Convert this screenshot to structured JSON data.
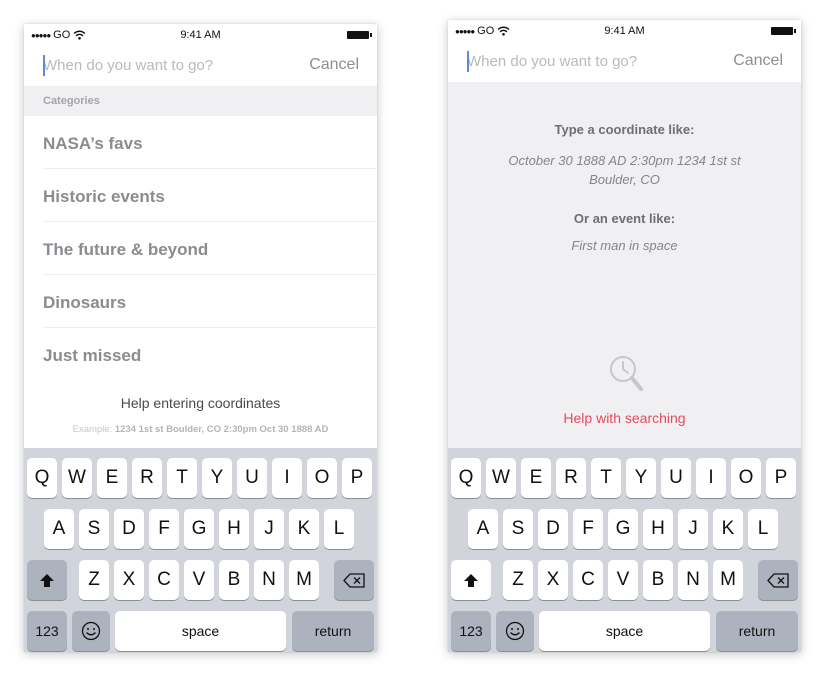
{
  "status_bar": {
    "carrier": "GO",
    "time": "9:41 AM"
  },
  "left_screen": {
    "search_placeholder": "When do you want to go?",
    "cancel_label": "Cancel",
    "section_header": "Categories",
    "categories": [
      "NASA’s favs",
      "Historic events",
      "The future & beyond",
      "Dinosaurs",
      "Just missed"
    ],
    "help_title": "Help entering coordinates",
    "example_prefix": "Example: ",
    "example_text": "1234 1st st Boulder, CO 2:30pm Oct 30 1888 AD"
  },
  "right_screen": {
    "search_placeholder": "When do you want to go?",
    "cancel_label": "Cancel",
    "coordinate_title": "Type a coordinate like:",
    "coordinate_example_line1": "October 30 1888 AD 2:30pm 1234 1st st",
    "coordinate_example_line2": "Boulder, CO",
    "event_title": "Or an event like:",
    "event_example": "First man in space",
    "help_link": "Help with searching"
  },
  "keyboard": {
    "row1": [
      "Q",
      "W",
      "E",
      "R",
      "T",
      "Y",
      "U",
      "I",
      "O",
      "P"
    ],
    "row2": [
      "A",
      "S",
      "D",
      "F",
      "G",
      "H",
      "J",
      "K",
      "L"
    ],
    "row3": [
      "Z",
      "X",
      "C",
      "V",
      "B",
      "N",
      "M"
    ],
    "numbers_label": "123",
    "space_label": "space",
    "return_label": "return"
  },
  "colors": {
    "accent_red": "#ea4a5a",
    "caret_blue": "#5b8bd8",
    "keyboard_bg": "#d1d5db"
  },
  "icons": [
    "wifi-icon",
    "battery-icon",
    "search-clock-icon",
    "shift-icon",
    "delete-icon",
    "emoji-icon"
  ]
}
